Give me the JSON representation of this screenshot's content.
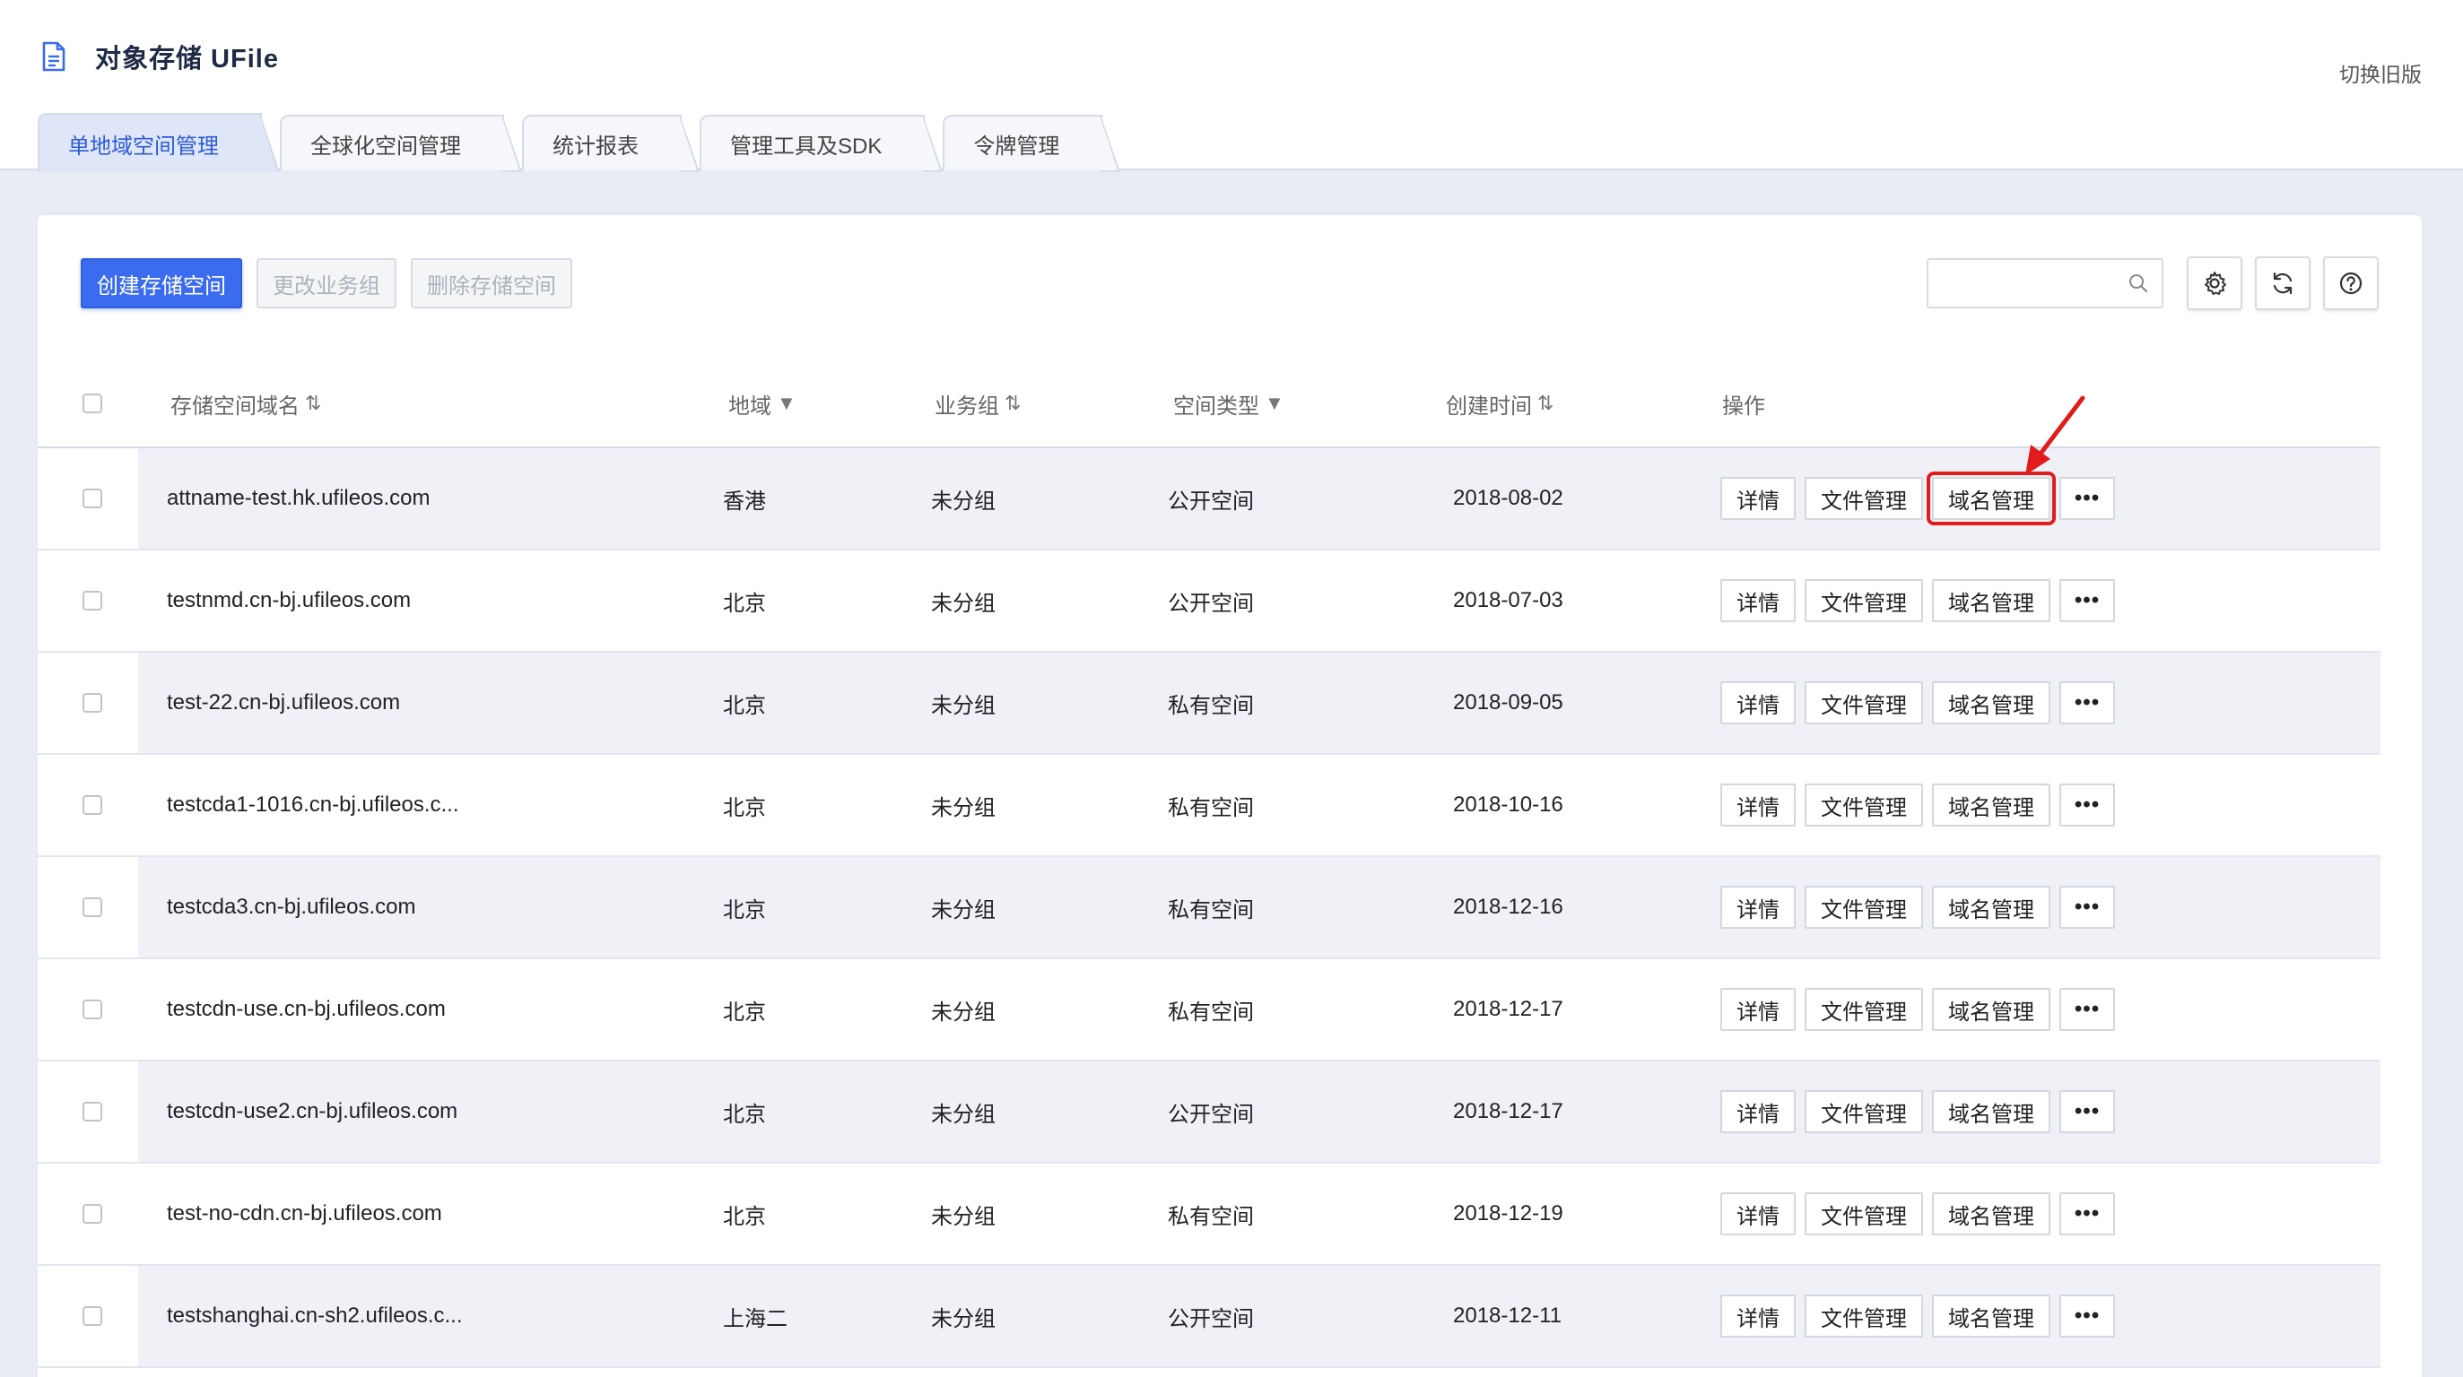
{
  "header": {
    "title": "对象存储 UFile",
    "switch_link": "切换旧版",
    "tabs": [
      {
        "label": "单地域空间管理",
        "active": true
      },
      {
        "label": "全球化空间管理",
        "active": false
      },
      {
        "label": "统计报表",
        "active": false
      },
      {
        "label": "管理工具及SDK",
        "active": false
      },
      {
        "label": "令牌管理",
        "active": false
      }
    ]
  },
  "toolbar": {
    "create_label": "创建存储空间",
    "change_group_label": "更改业务组",
    "delete_label": "删除存储空间",
    "search_placeholder": "",
    "settings_icon": "gear-icon",
    "refresh_icon": "refresh-icon",
    "help_icon": "help-icon"
  },
  "table": {
    "columns": {
      "domain": "存储空间域名",
      "region": "地域",
      "group": "业务组",
      "type": "空间类型",
      "created": "创建时间",
      "ops": "操作"
    },
    "ops_labels": {
      "detail": "详情",
      "files": "文件管理",
      "domains": "域名管理",
      "more": "•••"
    },
    "rows": [
      {
        "domain": "attname-test.hk.ufileos.com",
        "region": "香港",
        "group": "未分组",
        "type": "公开空间",
        "created": "2018-08-02",
        "highlight": true
      },
      {
        "domain": "testnmd.cn-bj.ufileos.com",
        "region": "北京",
        "group": "未分组",
        "type": "公开空间",
        "created": "2018-07-03"
      },
      {
        "domain": "test-22.cn-bj.ufileos.com",
        "region": "北京",
        "group": "未分组",
        "type": "私有空间",
        "created": "2018-09-05"
      },
      {
        "domain": "testcda1-1016.cn-bj.ufileos.c...",
        "region": "北京",
        "group": "未分组",
        "type": "私有空间",
        "created": "2018-10-16"
      },
      {
        "domain": "testcda3.cn-bj.ufileos.com",
        "region": "北京",
        "group": "未分组",
        "type": "私有空间",
        "created": "2018-12-16"
      },
      {
        "domain": "testcdn-use.cn-bj.ufileos.com",
        "region": "北京",
        "group": "未分组",
        "type": "私有空间",
        "created": "2018-12-17"
      },
      {
        "domain": "testcdn-use2.cn-bj.ufileos.com",
        "region": "北京",
        "group": "未分组",
        "type": "公开空间",
        "created": "2018-12-17"
      },
      {
        "domain": "test-no-cdn.cn-bj.ufileos.com",
        "region": "北京",
        "group": "未分组",
        "type": "私有空间",
        "created": "2018-12-19"
      },
      {
        "domain": "testshanghai.cn-sh2.ufileos.c...",
        "region": "上海二",
        "group": "未分组",
        "type": "公开空间",
        "created": "2018-12-11"
      }
    ]
  },
  "colors": {
    "primary": "#3b6cf0",
    "highlight": "#e21b1b",
    "active_tab_text": "#2c5bd9"
  }
}
